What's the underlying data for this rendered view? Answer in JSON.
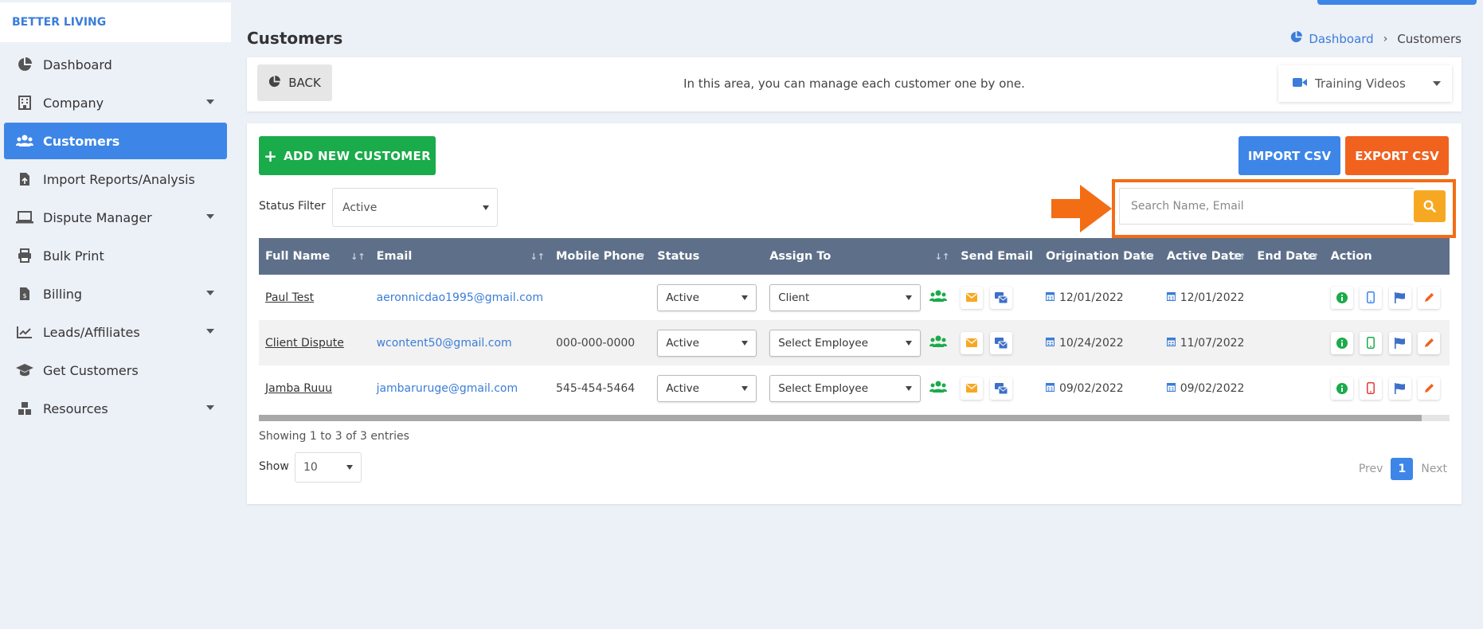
{
  "brand": "BETTER LIVING",
  "sidebar": {
    "items": [
      {
        "label": "Dashboard"
      },
      {
        "label": "Company"
      },
      {
        "label": "Customers"
      },
      {
        "label": "Import Reports/Analysis"
      },
      {
        "label": "Dispute Manager"
      },
      {
        "label": "Bulk Print"
      },
      {
        "label": "Billing"
      },
      {
        "label": "Leads/Affiliates"
      },
      {
        "label": "Get Customers"
      },
      {
        "label": "Resources"
      }
    ]
  },
  "header": {
    "title": "Customers",
    "breadcrumb": {
      "home": "Dashboard",
      "current": "Customers"
    }
  },
  "info_bar": {
    "back_label": "BACK",
    "message": "In this area, you can manage each customer one by one.",
    "training_label": "Training Videos"
  },
  "toolbar": {
    "add_label": "ADD NEW CUSTOMER",
    "import_label": "IMPORT CSV",
    "export_label": "EXPORT CSV",
    "status_filter_label": "Status Filter",
    "status_filter_value": "Active",
    "search_placeholder": "Search Name, Email"
  },
  "table": {
    "columns": [
      "Full Name",
      "Email",
      "Mobile Phone",
      "Status",
      "Assign To",
      "Send Email",
      "Origination Date",
      "Active Date",
      "End Date",
      "Action"
    ],
    "rows": [
      {
        "name": "Paul Test",
        "email": "aeronnicdao1995@gmail.com",
        "phone": "",
        "status": "Active",
        "assign": "Client",
        "origination": "12/01/2022",
        "active": "12/01/2022",
        "end": ""
      },
      {
        "name": "Client Dispute",
        "email": "wcontent50@gmail.com",
        "phone": "000-000-0000",
        "status": "Active",
        "assign": "Select Employee",
        "origination": "10/24/2022",
        "active": "11/07/2022",
        "end": ""
      },
      {
        "name": "Jamba Ruuu",
        "email": "jambaruruge@gmail.com",
        "phone": "545-454-5464",
        "status": "Active",
        "assign": "Select Employee",
        "origination": "09/02/2022",
        "active": "09/02/2022",
        "end": ""
      }
    ]
  },
  "footer": {
    "showing": "Showing 1 to 3 of 3 entries",
    "show_label": "Show",
    "page_size": "10",
    "prev": "Prev",
    "page": "1",
    "next": "Next"
  },
  "colors": {
    "primary": "#3d86e8",
    "success": "#1aab4a",
    "export": "#f0621e",
    "search_button": "#f7a823",
    "highlight": "#f36d15",
    "table_header": "#5e7089"
  }
}
